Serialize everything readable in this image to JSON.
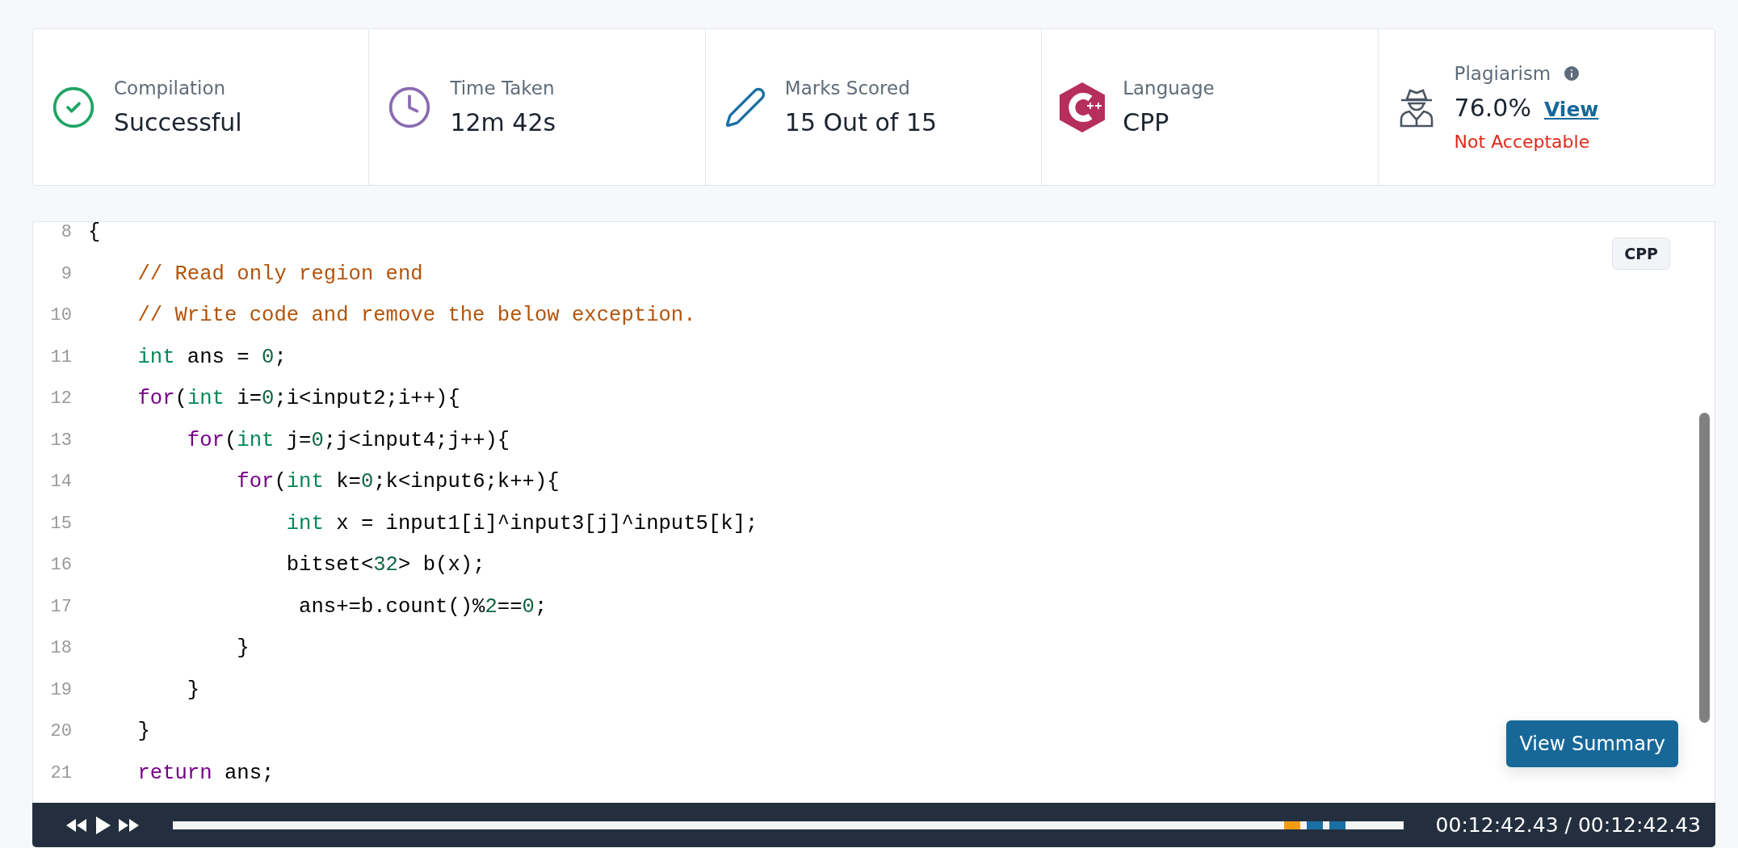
{
  "stats": [
    {
      "kind": "compilation",
      "label": "Compilation",
      "value": "Successful"
    },
    {
      "kind": "time",
      "label": "Time Taken",
      "value": "12m 42s"
    },
    {
      "kind": "marks",
      "label": "Marks Scored",
      "value": "15 Out of 15"
    },
    {
      "kind": "language",
      "label": "Language",
      "value": "CPP"
    },
    {
      "kind": "plagiarism",
      "label": "Plagiarism",
      "value": "76.0%",
      "link": "View",
      "status": "Not Acceptable"
    }
  ],
  "editor": {
    "language_badge": "CPP",
    "summary_button": "View Summary",
    "lines": [
      {
        "number": "8",
        "tokens": [
          {
            "kind": "plain",
            "text": "{"
          }
        ]
      },
      {
        "number": "9",
        "tokens": [
          {
            "kind": "comment",
            "text": "    // Read only region end"
          }
        ]
      },
      {
        "number": "10",
        "tokens": [
          {
            "kind": "comment",
            "text": "    // Write code and remove the below exception."
          }
        ]
      },
      {
        "number": "11",
        "tokens": [
          {
            "kind": "type",
            "text": "    int"
          },
          {
            "kind": "plain",
            "text": " ans = "
          },
          {
            "kind": "number",
            "text": "0"
          },
          {
            "kind": "plain",
            "text": ";"
          }
        ]
      },
      {
        "number": "12",
        "tokens": [
          {
            "kind": "keyword",
            "text": "    for"
          },
          {
            "kind": "plain",
            "text": "("
          },
          {
            "kind": "type",
            "text": "int"
          },
          {
            "kind": "plain",
            "text": " i="
          },
          {
            "kind": "number",
            "text": "0"
          },
          {
            "kind": "plain",
            "text": ";i<input2;i++){"
          }
        ]
      },
      {
        "number": "13",
        "tokens": [
          {
            "kind": "keyword",
            "text": "        for"
          },
          {
            "kind": "plain",
            "text": "("
          },
          {
            "kind": "type",
            "text": "int"
          },
          {
            "kind": "plain",
            "text": " j="
          },
          {
            "kind": "number",
            "text": "0"
          },
          {
            "kind": "plain",
            "text": ";j<input4;j++){"
          }
        ]
      },
      {
        "number": "14",
        "tokens": [
          {
            "kind": "keyword",
            "text": "            for"
          },
          {
            "kind": "plain",
            "text": "("
          },
          {
            "kind": "type",
            "text": "int"
          },
          {
            "kind": "plain",
            "text": " k="
          },
          {
            "kind": "number",
            "text": "0"
          },
          {
            "kind": "plain",
            "text": ";k<input6;k++){"
          }
        ]
      },
      {
        "number": "15",
        "tokens": [
          {
            "kind": "type",
            "text": "                int"
          },
          {
            "kind": "plain",
            "text": " x = input1[i]^input3[j]^input5[k];"
          }
        ]
      },
      {
        "number": "16",
        "tokens": [
          {
            "kind": "plain",
            "text": "                bitset<"
          },
          {
            "kind": "number",
            "text": "32"
          },
          {
            "kind": "plain",
            "text": "> b(x);"
          }
        ]
      },
      {
        "number": "17",
        "tokens": [
          {
            "kind": "plain",
            "text": "                 ans+=b.count()%"
          },
          {
            "kind": "number",
            "text": "2"
          },
          {
            "kind": "plain",
            "text": "=="
          },
          {
            "kind": "number",
            "text": "0"
          },
          {
            "kind": "plain",
            "text": ";"
          }
        ]
      },
      {
        "number": "18",
        "tokens": [
          {
            "kind": "plain",
            "text": "            }"
          }
        ]
      },
      {
        "number": "19",
        "tokens": [
          {
            "kind": "plain",
            "text": "        }"
          }
        ]
      },
      {
        "number": "20",
        "tokens": [
          {
            "kind": "plain",
            "text": "    }"
          }
        ]
      },
      {
        "number": "21",
        "tokens": [
          {
            "kind": "keyword",
            "text": "    return"
          },
          {
            "kind": "plain",
            "text": " ans;"
          }
        ]
      }
    ]
  },
  "player": {
    "playing": false,
    "level": 1,
    "time": "00:12:42.43 / 00:12:42.43",
    "markers": [
      {
        "color": "#f39c12"
      },
      {
        "color": "#1a6fa3"
      },
      {
        "color": "#1a6fa3"
      }
    ]
  }
}
